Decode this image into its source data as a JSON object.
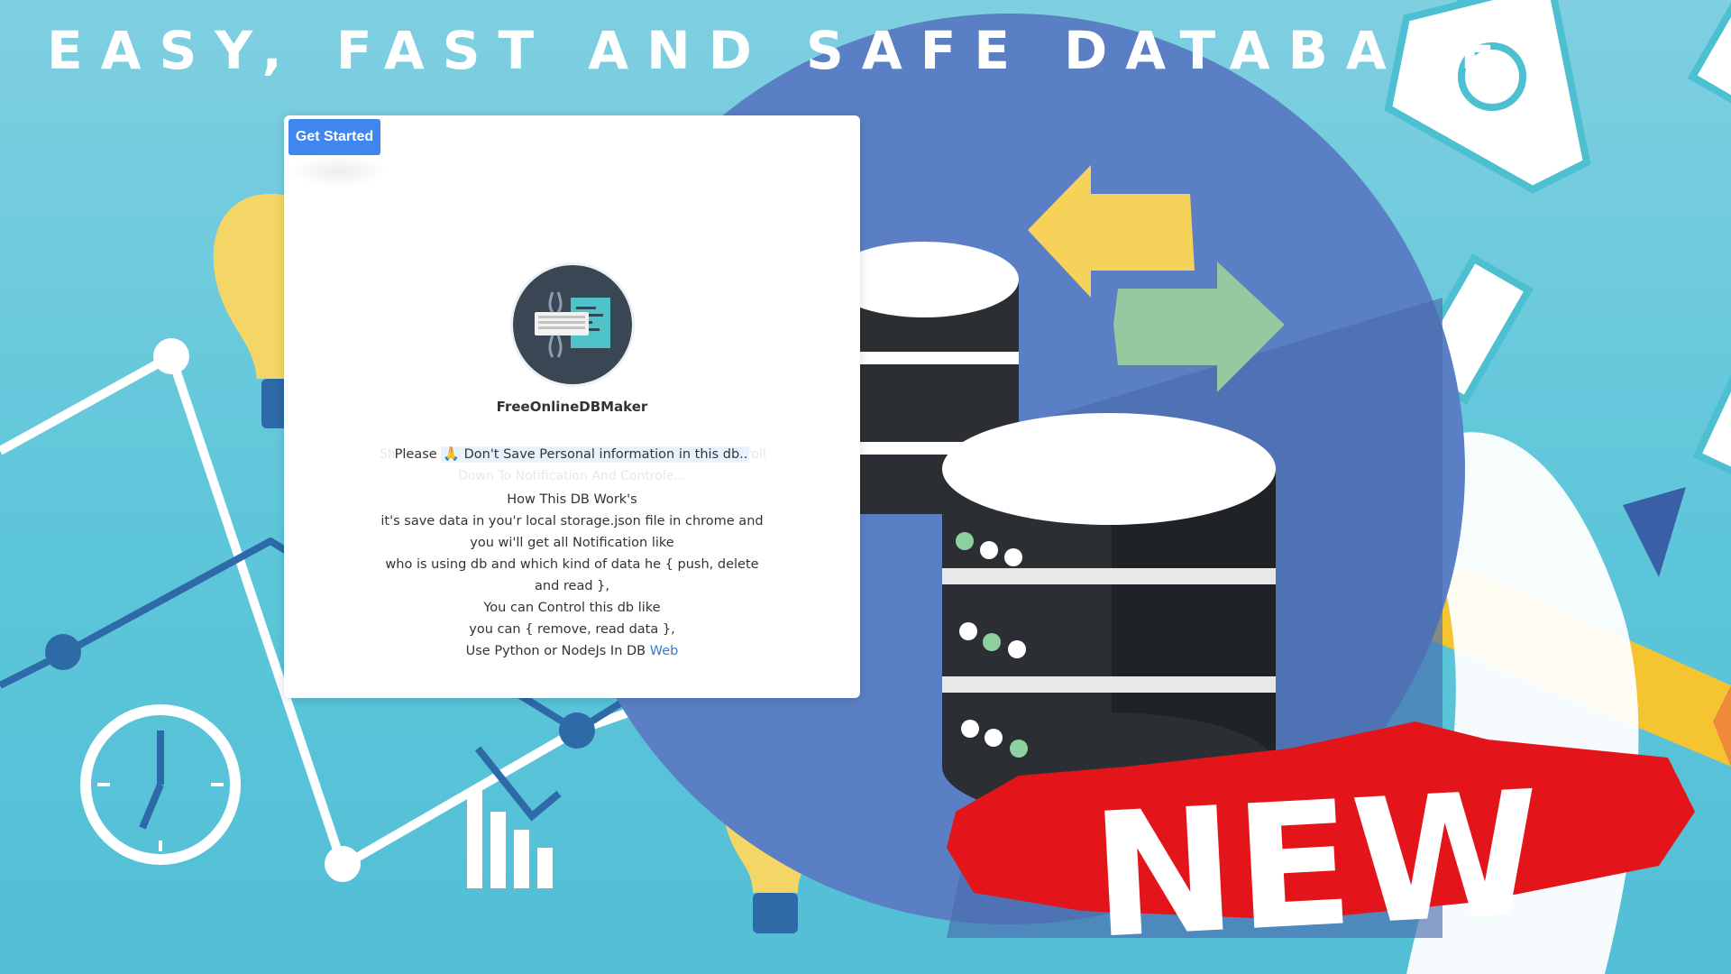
{
  "headline": "EASY, FAST AND SAFE DATABASE",
  "card": {
    "get_started_label": "Get Started",
    "app_name": "FreeOnlineDBMaker",
    "notice_prefix": "Please",
    "notice_icon": "folded-hands-icon",
    "notice_text": "Don't Save Personal information in this db..",
    "ghost_line_1_left": "Sh",
    "ghost_line_1_right": "roll",
    "ghost_line_2": "Down To Notification And Controle...",
    "info_lines": [
      "How This DB Work's",
      "it's save data in you'r local storage.json file in chrome and you wi'll get all Notification like",
      "who is using db and which kind of data he { push, delete and read },",
      "You can Control this db like",
      "you can { remove, read data },"
    ],
    "info_last_prefix": "Use Python or NodeJs In DB",
    "info_link": "Web"
  },
  "badge": "NEW",
  "colors": {
    "background": "#5ec6da",
    "accent_button": "#3f86ee",
    "circle": "#5a7fc4",
    "badge_red": "#e3151b",
    "arrow_yellow": "#f7d25b",
    "arrow_green": "#95c9a0"
  }
}
